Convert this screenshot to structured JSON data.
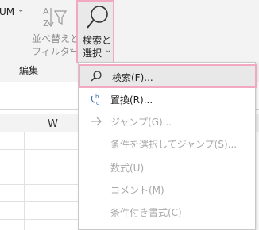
{
  "ribbon": {
    "partial_label": "UM",
    "sort_filter": {
      "line1": "並べ替えと",
      "line2": "フィルター"
    },
    "find_select": {
      "line1": "検索と",
      "line2": "選択"
    },
    "group_label": "編集"
  },
  "sheet": {
    "column_label": "W"
  },
  "menu": {
    "items": [
      {
        "label": "検索(F)...",
        "icon": "search-icon",
        "enabled": true
      },
      {
        "label": "置換(R)...",
        "icon": "replace-icon",
        "enabled": true
      },
      {
        "label": "ジャンプ(G)...",
        "icon": "arrow-right-icon",
        "enabled": false
      },
      {
        "label": "条件を選択してジャンプ(S)...",
        "icon": "",
        "enabled": false
      },
      {
        "label": "数式(U)",
        "icon": "",
        "enabled": false
      },
      {
        "label": "コメント(M)",
        "icon": "",
        "enabled": false
      },
      {
        "label": "条件付き書式(C)",
        "icon": "",
        "enabled": false
      }
    ]
  }
}
